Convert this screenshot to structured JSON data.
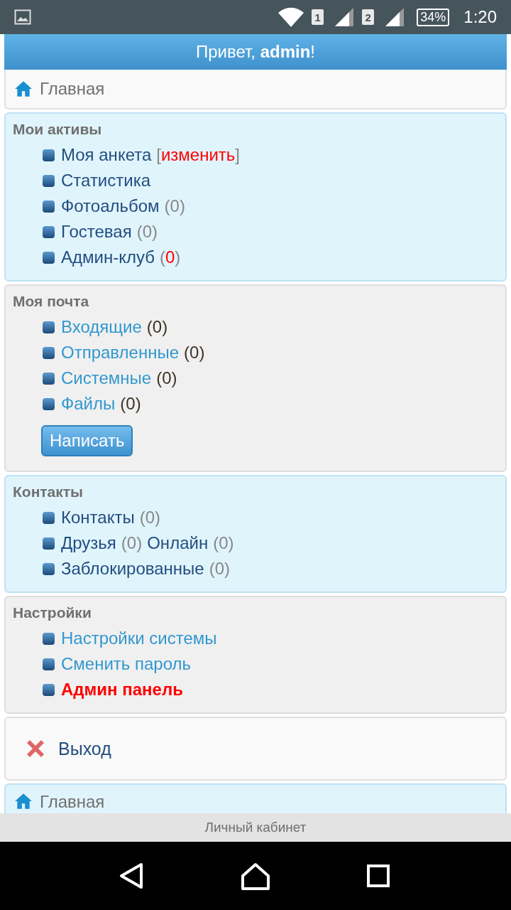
{
  "status_bar": {
    "sim_slots": [
      "1",
      "2"
    ],
    "battery": "34%",
    "time": "1:20"
  },
  "greeting": {
    "prefix": "Привет, ",
    "user": "admin",
    "suffix": "!"
  },
  "home_link": {
    "label": "Главная"
  },
  "sections": [
    {
      "title": "Мои активы",
      "items": [
        {
          "parts": [
            {
              "kind": "link",
              "text": "Моя анкета"
            },
            {
              "kind": "edit",
              "open": "[",
              "value": "изменить",
              "close": "]"
            }
          ]
        },
        {
          "parts": [
            {
              "kind": "link",
              "text": "Статистика"
            }
          ]
        },
        {
          "parts": [
            {
              "kind": "link",
              "text": "Фотоальбом"
            },
            {
              "kind": "count",
              "open": "(",
              "value": "0",
              "close": ")",
              "alert": false
            }
          ]
        },
        {
          "parts": [
            {
              "kind": "link",
              "text": "Гостевая"
            },
            {
              "kind": "count",
              "open": "(",
              "value": "0",
              "close": ")",
              "alert": false
            }
          ]
        },
        {
          "parts": [
            {
              "kind": "link",
              "text": "Админ-клуб"
            },
            {
              "kind": "count",
              "open": "(",
              "value": "0",
              "close": ")",
              "alert": true
            }
          ]
        }
      ]
    },
    {
      "title": "Моя почта",
      "button": "Написать",
      "items": [
        {
          "parts": [
            {
              "kind": "link",
              "text": "Входящие"
            },
            {
              "kind": "count",
              "open": "(",
              "value": "0",
              "close": ")",
              "alert": false
            }
          ]
        },
        {
          "parts": [
            {
              "kind": "link",
              "text": "Отправленные"
            },
            {
              "kind": "count",
              "open": "(",
              "value": "0",
              "close": ")",
              "alert": false
            }
          ]
        },
        {
          "parts": [
            {
              "kind": "link",
              "text": "Системные"
            },
            {
              "kind": "count",
              "open": "(",
              "value": "0",
              "close": ")",
              "alert": false
            }
          ]
        },
        {
          "parts": [
            {
              "kind": "link",
              "text": "Файлы"
            },
            {
              "kind": "count",
              "open": "(",
              "value": "0",
              "close": ")",
              "alert": false
            }
          ]
        }
      ]
    },
    {
      "title": "Контакты",
      "items": [
        {
          "parts": [
            {
              "kind": "link",
              "text": "Контакты"
            },
            {
              "kind": "count",
              "open": "(",
              "value": "0",
              "close": ")",
              "alert": false
            }
          ]
        },
        {
          "parts": [
            {
              "kind": "link",
              "text": "Друзья"
            },
            {
              "kind": "count",
              "open": "(",
              "value": "0",
              "close": ")",
              "alert": false
            },
            {
              "kind": "link",
              "text": "Онлайн"
            },
            {
              "kind": "count",
              "open": "(",
              "value": "0",
              "close": ")",
              "alert": false
            }
          ]
        },
        {
          "parts": [
            {
              "kind": "link",
              "text": "Заблокированные"
            },
            {
              "kind": "count",
              "open": "(",
              "value": "0",
              "close": ")",
              "alert": false
            }
          ]
        }
      ]
    },
    {
      "title": "Настройки",
      "items": [
        {
          "parts": [
            {
              "kind": "link",
              "text": "Настройки системы"
            }
          ]
        },
        {
          "parts": [
            {
              "kind": "link",
              "text": "Сменить пароль"
            }
          ]
        },
        {
          "parts": [
            {
              "kind": "alert_link",
              "text": "Админ панель"
            }
          ]
        }
      ]
    }
  ],
  "logout": {
    "label": "Выход"
  },
  "bottom_home": {
    "label": "Главная"
  },
  "footer": {
    "title": "Личный кабинет"
  }
}
